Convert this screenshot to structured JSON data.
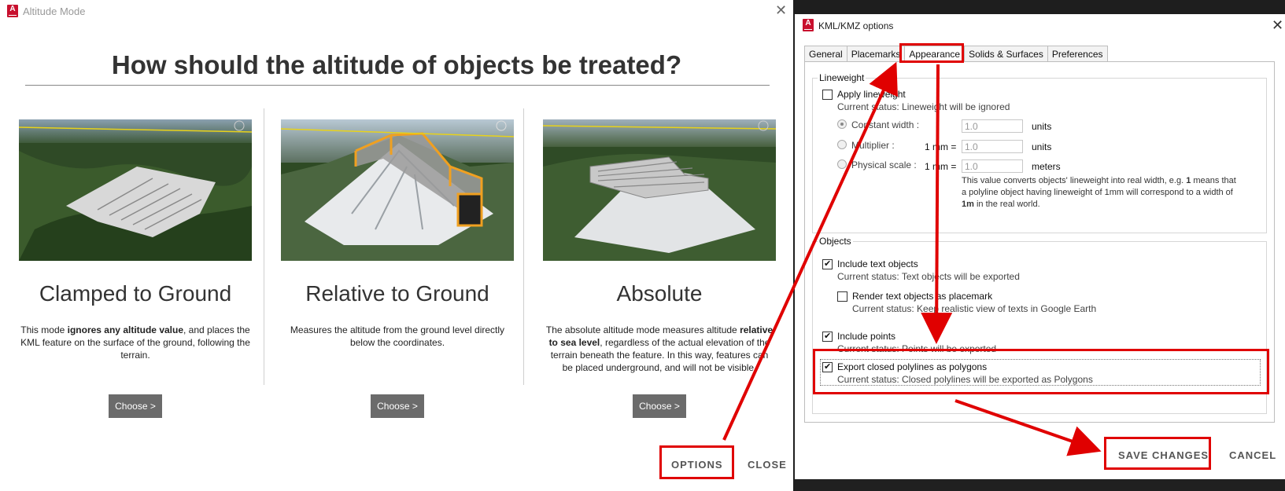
{
  "left_window": {
    "title": "Altitude Mode",
    "heading": "How should the altitude of objects be treated?",
    "modes": [
      {
        "title": "Clamped to Ground",
        "desc_parts": [
          {
            "t": "This mode ",
            "b": false
          },
          {
            "t": "ignores any altitude value",
            "b": true
          },
          {
            "t": ", and places the KML feature on the surface of the ground, following the terrain.",
            "b": false
          }
        ],
        "button": "Choose >"
      },
      {
        "title": "Relative to Ground",
        "desc_parts": [
          {
            "t": "Measures the altitude from the ground level directly below the coordinates.",
            "b": false
          }
        ],
        "button": "Choose >"
      },
      {
        "title": "Absolute",
        "desc_parts": [
          {
            "t": "The absolute altitude mode measures altitude ",
            "b": false
          },
          {
            "t": "relative to sea level",
            "b": true
          },
          {
            "t": ", regardless of the actual elevation of the terrain beneath the feature. In this way, features can be placed underground, and will not be visible.",
            "b": false
          }
        ],
        "button": "Choose >"
      }
    ],
    "options_label": "OPTIONS",
    "close_label": "CLOSE"
  },
  "right_window": {
    "title": "KML/KMZ options",
    "tabs": [
      "General",
      "Placemarks",
      "Appearance",
      "Solids & Surfaces",
      "Preferences"
    ],
    "active_tab": "Appearance",
    "lineweight": {
      "group_label": "Lineweight",
      "apply_label": "Apply lineweight",
      "apply_checked": false,
      "apply_status": "Current status: Lineweight will be ignored",
      "constant_width_label": "Constant width :",
      "constant_width_value": "1.0",
      "constant_width_unit": "units",
      "multiplier_label": "Multiplier :",
      "multiplier_prefix": "1 mm =",
      "multiplier_value": "1.0",
      "multiplier_unit": "units",
      "physical_label": "Physical scale :",
      "physical_prefix": "1 mm =",
      "physical_value": "1.0",
      "physical_unit": "meters",
      "note_parts": [
        {
          "t": "This value converts objects' lineweight into real width, e.g. ",
          "b": false
        },
        {
          "t": "1",
          "b": true
        },
        {
          "t": " means that a polyline object having lineweight of 1mm will correspond to a width of ",
          "b": false
        },
        {
          "t": "1m",
          "b": true
        },
        {
          "t": " in the real world.",
          "b": false
        }
      ]
    },
    "objects": {
      "group_label": "Objects",
      "include_text_label": "Include text objects",
      "include_text_checked": true,
      "include_text_status": "Current status: Text objects will be exported",
      "render_text_label": "Render text objects as placemark",
      "render_text_checked": false,
      "render_text_status": "Current status: Keep realistic view of texts in Google Earth",
      "include_points_label": "Include points",
      "include_points_checked": true,
      "include_points_status": "Current status: Points will be exported",
      "export_polygons_label": "Export closed polylines as polygons",
      "export_polygons_checked": true,
      "export_polygons_status": "Current status: Closed polylines will be exported as Polygons"
    },
    "save_label": "SAVE CHANGES",
    "cancel_label": "CANCEL"
  },
  "colors": {
    "annotation": "#e00000",
    "choose_button": "#6b6b6b",
    "autodesk_red": "#c8102e",
    "footprint_orange": "#f0a020"
  },
  "icons": {
    "app": "autodesk-app-icon",
    "close": "close-icon"
  }
}
